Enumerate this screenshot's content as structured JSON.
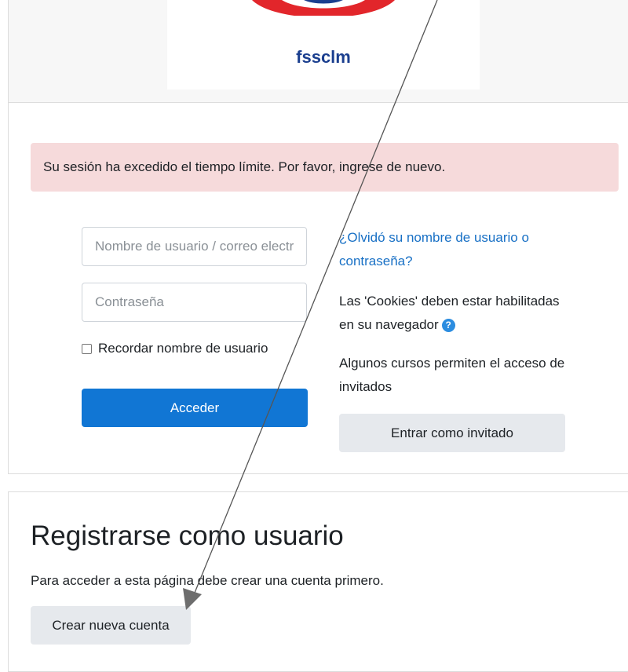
{
  "logo": {
    "text": "fssclm",
    "ring_colors": [
      "#e2262b",
      "#ffffff",
      "#1b3f8f"
    ]
  },
  "alert": {
    "message": "Su sesión ha excedido el tiempo límite. Por favor, ingrese de nuevo."
  },
  "login": {
    "username_placeholder": "Nombre de usuario / correo electrónico",
    "password_placeholder": "Contraseña",
    "remember_label": "Recordar nombre de usuario",
    "submit_label": "Acceder",
    "forgot_link": "¿Olvidó su nombre de usuario o contraseña?",
    "cookies_text": "Las 'Cookies' deben estar habilitadas en su navegador",
    "guest_text": "Algunos cursos permiten el acceso de invitados",
    "guest_button": "Entrar como invitado"
  },
  "signup": {
    "title": "Registrarse como usuario",
    "description": "Para acceder a esta página debe crear una cuenta primero.",
    "button": "Crear nueva cuenta"
  },
  "icons": {
    "help": "question-circle-icon"
  },
  "colors": {
    "primary": "#1176d4",
    "link": "#1870c5",
    "alert_bg": "#f6dadb",
    "secondary_btn": "#e6e9ed"
  }
}
